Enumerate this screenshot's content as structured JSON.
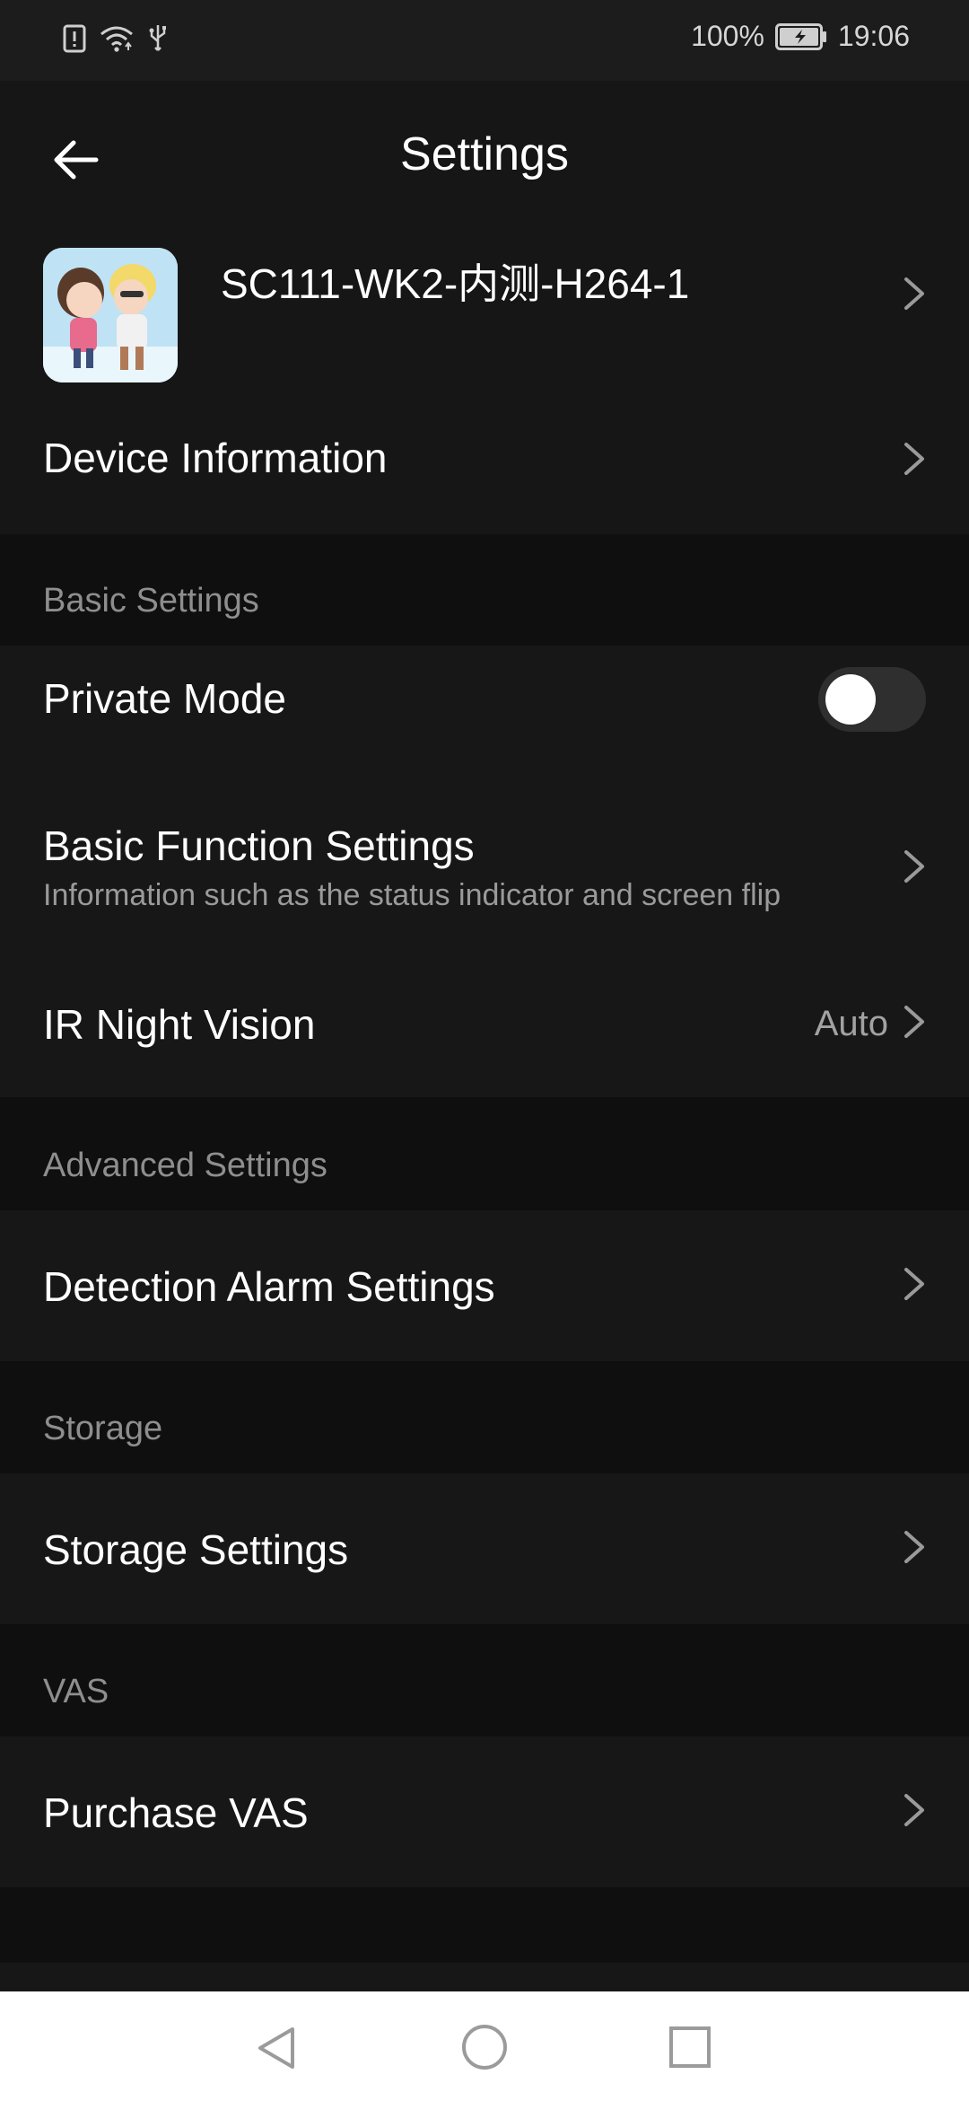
{
  "status_bar": {
    "battery": "100%",
    "time": "19:06",
    "icons": [
      "sim-alert-icon",
      "wifi-icon",
      "usb-icon",
      "battery-icon"
    ]
  },
  "header": {
    "title": "Settings",
    "back_icon": "arrow-left-icon"
  },
  "device": {
    "name": "SC111-WK2-内测-H264-1",
    "thumbnail_icon": "cartoon-couple-avatar",
    "device_info_label": "Device Information"
  },
  "sections": {
    "basic": {
      "header": "Basic Settings",
      "private_mode_label": "Private Mode",
      "private_mode_on": false,
      "basic_function_label": "Basic Function Settings",
      "basic_function_sub": "Information such as the status indicator and screen flip",
      "ir_label": "IR Night Vision",
      "ir_value": "Auto"
    },
    "advanced": {
      "header": "Advanced Settings",
      "detection_label": "Detection Alarm Settings"
    },
    "storage": {
      "header": "Storage",
      "storage_label": "Storage Settings"
    },
    "vas": {
      "header": "VAS",
      "purchase_label": "Purchase VAS"
    }
  },
  "colors": {
    "background": "#0f0f0f",
    "card": "#171717",
    "text_primary": "#ffffff",
    "text_secondary": "#9a9a9a",
    "toggle_track": "#2f2f2f"
  },
  "nav_bar": {
    "icons": [
      "nav-back-icon",
      "nav-home-icon",
      "nav-recents-icon"
    ]
  }
}
